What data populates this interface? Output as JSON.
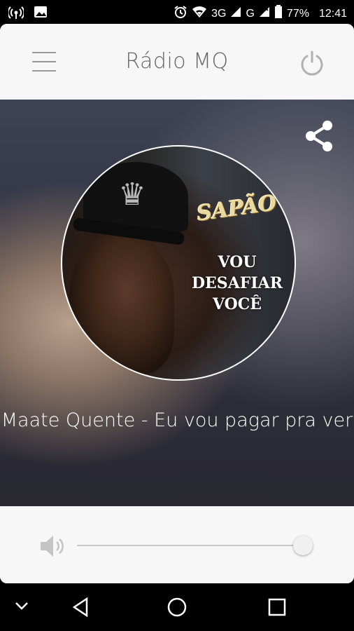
{
  "status_bar": {
    "network": "3G",
    "second_network": "G",
    "battery": "77%",
    "time": "12:41",
    "icons": [
      "hotspot-icon",
      "image-icon",
      "alarm-icon",
      "wifi-icon",
      "signal-icon",
      "signal-icon",
      "battery-icon"
    ]
  },
  "header": {
    "title": "Rádio MQ",
    "menu_icon": "menu-icon",
    "power_icon": "power-icon"
  },
  "player": {
    "share_icon": "share-icon",
    "album": {
      "brand": "SAPÃO",
      "line1": "VOU",
      "line2": "DESAFIAR",
      "line3": "VOCÊ"
    },
    "track_title": "Maate Quente - Eu vou pagar pra ver"
  },
  "volume": {
    "icon": "speaker-icon",
    "level": 0.98
  },
  "navigation": {
    "icons": [
      "chevron-down-icon",
      "back-icon",
      "home-icon",
      "recents-icon"
    ]
  },
  "colors": {
    "header_bg": "#f7f7f7",
    "title_text": "#666666",
    "accent_gray": "#999999"
  }
}
